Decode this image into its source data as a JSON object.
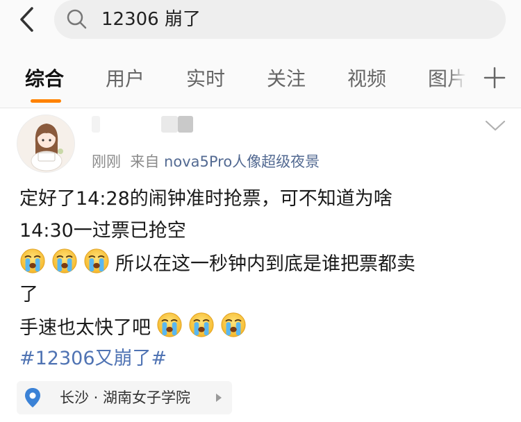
{
  "search": {
    "query": "12306 崩了"
  },
  "tabs": [
    {
      "label": "综合",
      "active": true
    },
    {
      "label": "用户",
      "active": false
    },
    {
      "label": "实时",
      "active": false
    },
    {
      "label": "关注",
      "active": false
    },
    {
      "label": "视频",
      "active": false
    },
    {
      "label": "图片",
      "active": false
    }
  ],
  "post": {
    "time": "刚刚",
    "source_prefix": "来自",
    "source": "nova5Pro人像超级夜景",
    "lines": [
      "定好了14:28的闹钟准时抢票，可不知道为啥",
      "14:30一过票已抢空",
      "所以在这一秒钟内到底是谁把票都卖",
      "了",
      "手速也太快了吧"
    ],
    "emoji_name": "crying-face-emoji",
    "hashtag": "#12306又崩了#",
    "location": "长沙 · 湖南女子学院"
  },
  "colors": {
    "accent": "#ff8200",
    "link": "#4f73b3",
    "source_link": "#536a92",
    "location_pin": "#3b82d6"
  }
}
